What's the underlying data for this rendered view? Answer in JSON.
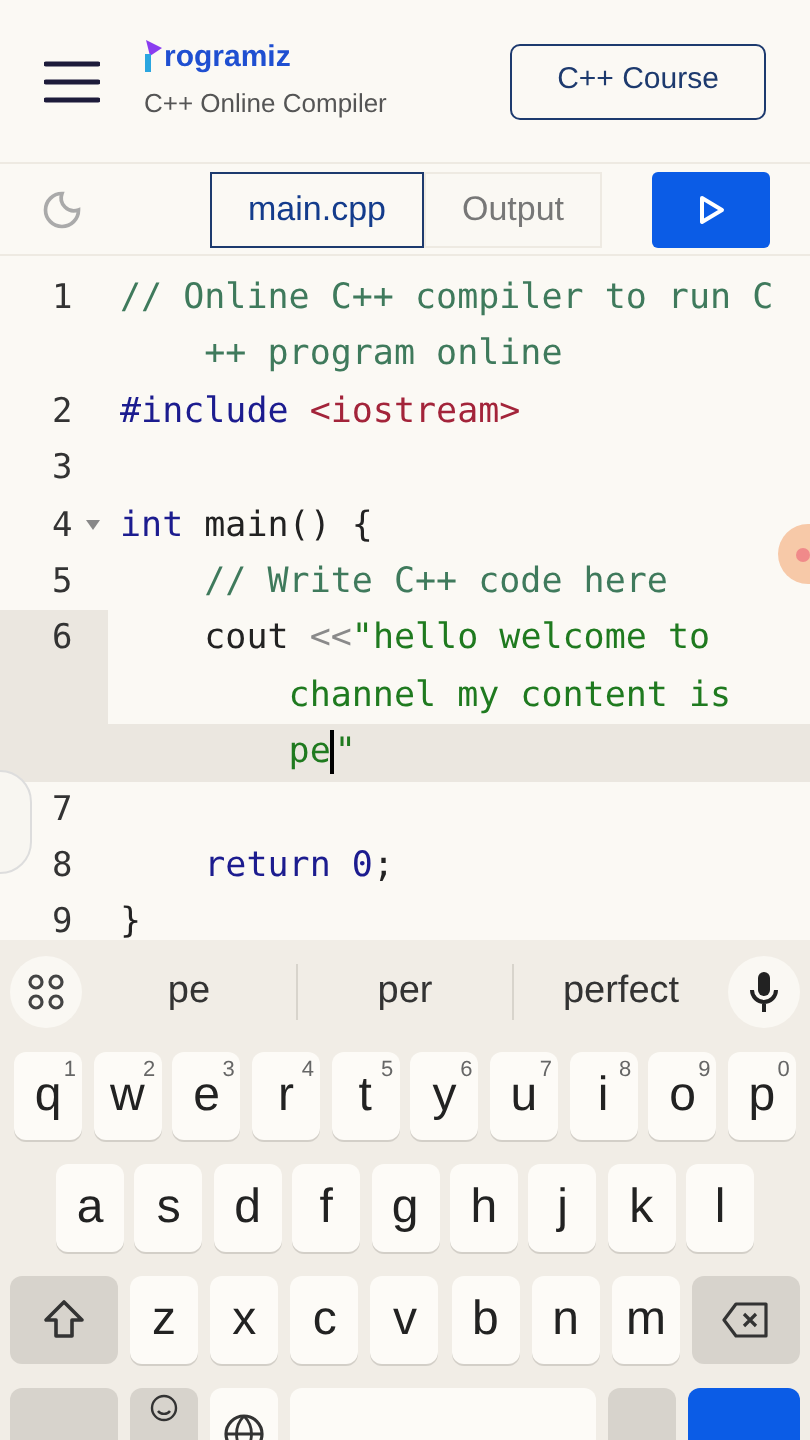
{
  "header": {
    "logo_text": "rogramiz",
    "subtitle": "C++ Online Compiler",
    "course_button": "C++ Course"
  },
  "toolbar": {
    "tabs": [
      {
        "label": "main.cpp",
        "selected": true
      },
      {
        "label": "Output",
        "selected": false
      }
    ]
  },
  "editor": {
    "lines": [
      {
        "number": "1",
        "active": false,
        "foldable": false,
        "rows": [
          {
            "tokens": [
              {
                "kind": "comment",
                "text": "// Online C++ compiler to run C"
              }
            ]
          },
          {
            "tokens": [
              {
                "kind": "comment",
                "text": "++ program online"
              }
            ]
          }
        ]
      },
      {
        "number": "2",
        "active": false,
        "foldable": false,
        "rows": [
          {
            "tokens": [
              {
                "kind": "meta",
                "text": "#include "
              },
              {
                "kind": "header",
                "text": "<iostream>"
              }
            ]
          }
        ]
      },
      {
        "number": "3",
        "active": false,
        "foldable": false,
        "rows": [
          {
            "tokens": []
          }
        ]
      },
      {
        "number": "4",
        "active": false,
        "foldable": true,
        "rows": [
          {
            "tokens": [
              {
                "kind": "keyword",
                "text": "int"
              },
              {
                "kind": "plain",
                "text": " main() {"
              }
            ]
          }
        ]
      },
      {
        "number": "5",
        "active": false,
        "foldable": false,
        "rows": [
          {
            "tokens": [
              {
                "kind": "comment",
                "text": "    // Write C++ code here"
              }
            ]
          }
        ]
      },
      {
        "number": "6",
        "active": true,
        "foldable": false,
        "rows": [
          {
            "tokens": [
              {
                "kind": "plain",
                "text": "    cout "
              },
              {
                "kind": "operator",
                "text": "<<"
              },
              {
                "kind": "string",
                "text": "\"hello welcome to"
              }
            ]
          },
          {
            "tokens": [
              {
                "kind": "string",
                "text": "channel my content is"
              }
            ]
          },
          {
            "tokens": [
              {
                "kind": "string",
                "text": "pe",
                "cursor_after": true
              },
              {
                "kind": "string",
                "text": "\""
              }
            ]
          }
        ]
      },
      {
        "number": "7",
        "active": false,
        "foldable": false,
        "rows": [
          {
            "tokens": []
          }
        ]
      },
      {
        "number": "8",
        "active": false,
        "foldable": false,
        "rows": [
          {
            "tokens": [
              {
                "kind": "keyword",
                "text": "    return "
              },
              {
                "kind": "number",
                "text": "0"
              },
              {
                "kind": "plain",
                "text": ";"
              }
            ]
          }
        ]
      },
      {
        "number": "9",
        "active": false,
        "foldable": false,
        "rows": [
          {
            "tokens": [
              {
                "kind": "plain",
                "text": "}"
              }
            ]
          }
        ]
      }
    ]
  },
  "keyboard": {
    "suggestions": [
      "pe",
      "per",
      "perfect"
    ],
    "rows": [
      [
        {
          "key": "q",
          "hint": "1"
        },
        {
          "key": "w",
          "hint": "2"
        },
        {
          "key": "e",
          "hint": "3"
        },
        {
          "key": "r",
          "hint": "4"
        },
        {
          "key": "t",
          "hint": "5"
        },
        {
          "key": "y",
          "hint": "6"
        },
        {
          "key": "u",
          "hint": "7"
        },
        {
          "key": "i",
          "hint": "8"
        },
        {
          "key": "o",
          "hint": "9"
        },
        {
          "key": "p",
          "hint": "0"
        }
      ],
      [
        {
          "key": "a"
        },
        {
          "key": "s"
        },
        {
          "key": "d"
        },
        {
          "key": "f"
        },
        {
          "key": "g"
        },
        {
          "key": "h"
        },
        {
          "key": "j"
        },
        {
          "key": "k"
        },
        {
          "key": "l"
        }
      ],
      [
        {
          "key": "z"
        },
        {
          "key": "x"
        },
        {
          "key": "c"
        },
        {
          "key": "v"
        },
        {
          "key": "b"
        },
        {
          "key": "n"
        },
        {
          "key": "m"
        }
      ]
    ]
  }
}
